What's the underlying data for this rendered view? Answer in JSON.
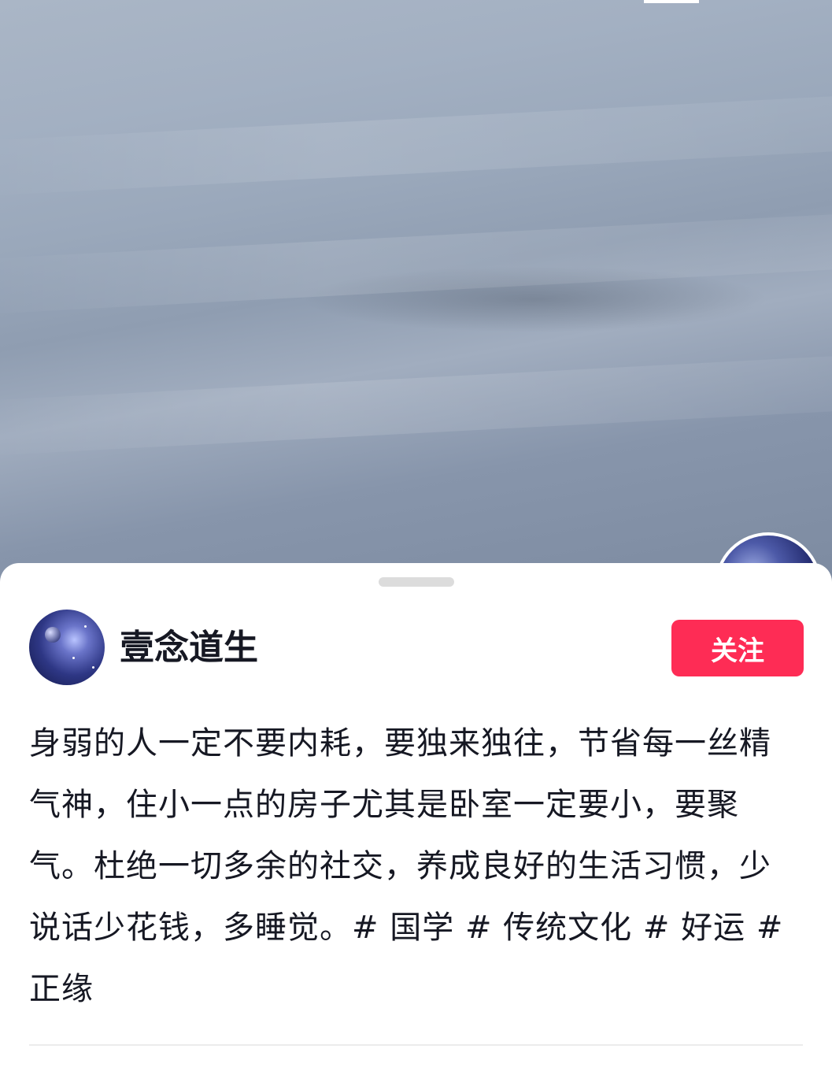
{
  "author": {
    "name": "壹念道生",
    "follow_label": "关注"
  },
  "post": {
    "description": "身弱的人一定不要内耗，要独来独往，节省每一丝精气神，住小一点的房子尤其是卧室一定要小，要聚气。杜绝一切多余的社交，养成良好的生活习惯，少说话少花钱，多睡觉。# 国学 # 传统文化 # 好运 # 正缘"
  },
  "colors": {
    "follow_button": "#fe2c55",
    "text": "#161823"
  }
}
